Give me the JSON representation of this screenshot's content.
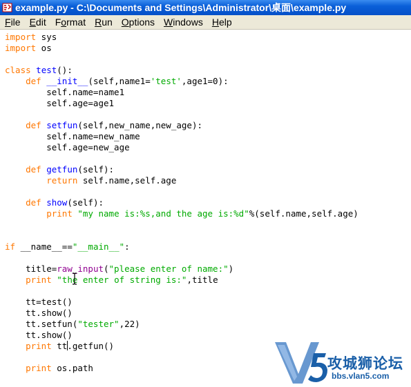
{
  "window": {
    "title": "example.py - C:\\Documents and Settings\\Administrator\\桌面\\example.py"
  },
  "menu": {
    "items": [
      {
        "mnemonic": "F",
        "rest": "ile"
      },
      {
        "mnemonic": "E",
        "rest": "dit"
      },
      {
        "mnemonic": "",
        "rest": "Format",
        "mnemonic_mid": true
      },
      {
        "mnemonic": "R",
        "rest": "un"
      },
      {
        "mnemonic": "O",
        "rest": "ptions"
      },
      {
        "mnemonic": "W",
        "rest": "indows"
      },
      {
        "mnemonic": "H",
        "rest": "elp"
      }
    ],
    "format_pre": "F",
    "format_mn": "o",
    "format_post": "rmat"
  },
  "code": {
    "lines": [
      [
        {
          "t": "import",
          "c": "kw"
        },
        {
          "t": " sys"
        }
      ],
      [
        {
          "t": "import",
          "c": "kw"
        },
        {
          "t": " os"
        }
      ],
      [],
      [
        {
          "t": "class",
          "c": "kw"
        },
        {
          "t": " "
        },
        {
          "t": "test",
          "c": "def"
        },
        {
          "t": "():"
        }
      ],
      [
        {
          "t": "    "
        },
        {
          "t": "def",
          "c": "kw"
        },
        {
          "t": " "
        },
        {
          "t": "__init__",
          "c": "def"
        },
        {
          "t": "(self,name1="
        },
        {
          "t": "'test'",
          "c": "str"
        },
        {
          "t": ",age1=0):"
        }
      ],
      [
        {
          "t": "        self.name=name1"
        }
      ],
      [
        {
          "t": "        self.age=age1"
        }
      ],
      [],
      [
        {
          "t": "    "
        },
        {
          "t": "def",
          "c": "kw"
        },
        {
          "t": " "
        },
        {
          "t": "setfun",
          "c": "def"
        },
        {
          "t": "(self,new_name,new_age):"
        }
      ],
      [
        {
          "t": "        self.name=new_name"
        }
      ],
      [
        {
          "t": "        self.age=new_age"
        }
      ],
      [],
      [
        {
          "t": "    "
        },
        {
          "t": "def",
          "c": "kw"
        },
        {
          "t": " "
        },
        {
          "t": "getfun",
          "c": "def"
        },
        {
          "t": "(self):"
        }
      ],
      [
        {
          "t": "        "
        },
        {
          "t": "return",
          "c": "kw"
        },
        {
          "t": " self.name,self.age"
        }
      ],
      [],
      [
        {
          "t": "    "
        },
        {
          "t": "def",
          "c": "kw"
        },
        {
          "t": " "
        },
        {
          "t": "show",
          "c": "def"
        },
        {
          "t": "(self):"
        }
      ],
      [
        {
          "t": "        "
        },
        {
          "t": "print",
          "c": "kw"
        },
        {
          "t": " "
        },
        {
          "t": "\"my name is:%s,and the age is:%d\"",
          "c": "str"
        },
        {
          "t": "%(self.name,self.age)"
        }
      ],
      [],
      [],
      [
        {
          "t": "if",
          "c": "kw"
        },
        {
          "t": " __name__=="
        },
        {
          "t": "\"__main__\"",
          "c": "str"
        },
        {
          "t": ":"
        }
      ],
      [],
      [
        {
          "t": "    title="
        },
        {
          "t": "raw_input",
          "c": "bi"
        },
        {
          "t": "("
        },
        {
          "t": "\"please enter of name:\"",
          "c": "str"
        },
        {
          "t": ")"
        }
      ],
      [
        {
          "t": "    "
        },
        {
          "t": "print",
          "c": "kw"
        },
        {
          "t": " "
        },
        {
          "t": "\"the enter of string is:\"",
          "c": "str"
        },
        {
          "t": ",title"
        }
      ],
      [],
      [
        {
          "t": "    tt=test()"
        }
      ],
      [
        {
          "t": "    tt.show()"
        }
      ],
      [
        {
          "t": "    tt.setfun("
        },
        {
          "t": "\"tester\"",
          "c": "str"
        },
        {
          "t": ",22)"
        }
      ],
      [
        {
          "t": "    tt.show()"
        }
      ],
      [
        {
          "t": "    "
        },
        {
          "t": "print",
          "c": "kw"
        },
        {
          "t": " tt"
        },
        {
          "t": "",
          "c": "cursor"
        },
        {
          "t": ".getfun()"
        }
      ],
      [],
      [
        {
          "t": "    "
        },
        {
          "t": "print",
          "c": "kw"
        },
        {
          "t": " os.path"
        }
      ]
    ]
  },
  "watermark": {
    "text": "攻城狮论坛",
    "url": "bbs.vlan5.com"
  },
  "colors": {
    "keyword": "#ff7700",
    "definition": "#0000ff",
    "string": "#00aa00",
    "builtin": "#900090"
  }
}
